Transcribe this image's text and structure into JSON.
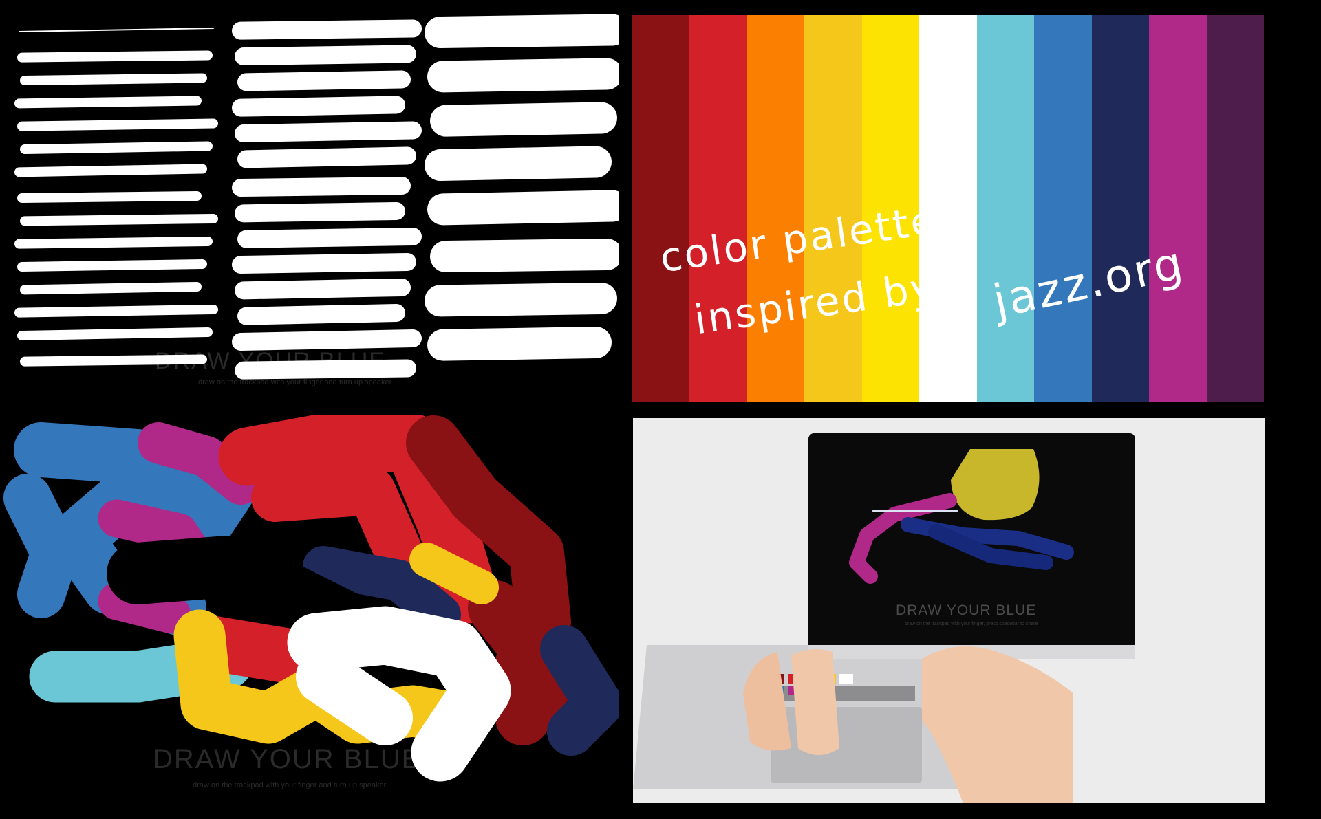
{
  "panels": {
    "strokes": {
      "watermark_title": "DRAW YOUR BLUE",
      "watermark_sub": "draw on the trackpad with your finger and turn up speaker"
    },
    "palette": {
      "line1": "color palette",
      "line2": "inspired by",
      "line3": "jazz.org",
      "colors": [
        "#8a1214",
        "#d42029",
        "#fb7f01",
        "#f6c71b",
        "#fde301",
        "#ffffff",
        "#6bc7d6",
        "#3478bb",
        "#1f2a5b",
        "#b02988",
        "#4f1d4b"
      ]
    },
    "scribble": {
      "watermark_title": "DRAW YOUR BLUE",
      "watermark_sub": "draw on the trackpad with your finger and turn up speaker"
    },
    "photo": {
      "screen_title": "DRAW YOUR BLUE",
      "screen_sub": "draw on the trackpad with your finger, press spacebar to share"
    }
  }
}
